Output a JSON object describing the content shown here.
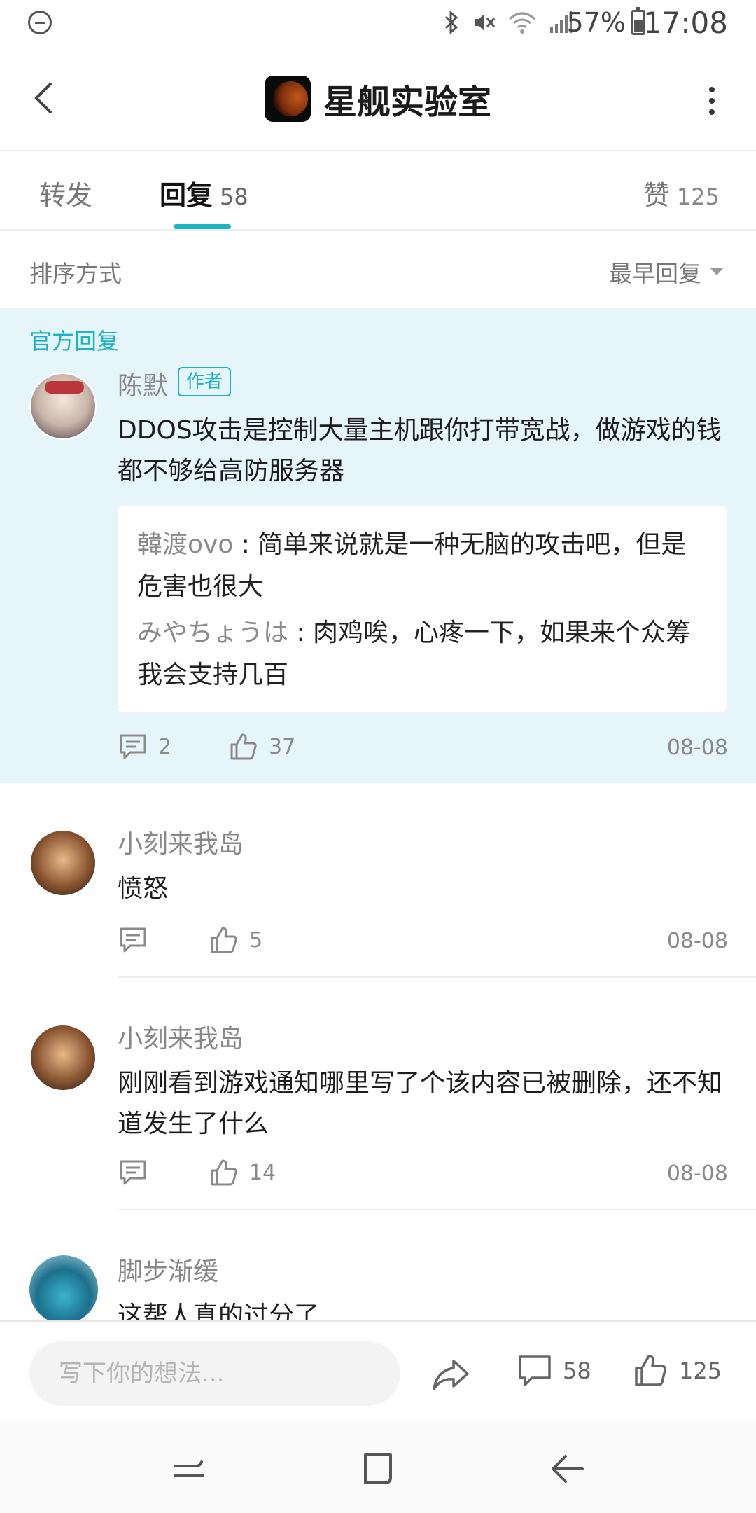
{
  "status_bar": {
    "battery": "57%",
    "time": "17:08",
    "battery_level": 0.57
  },
  "header": {
    "title": "星舰实验室",
    "logo": "moon-logo-icon"
  },
  "tabs": [
    {
      "label": "转发",
      "count": ""
    },
    {
      "label": "回复",
      "count": "58",
      "active": true
    },
    {
      "label": "赞",
      "count": "125"
    }
  ],
  "sort": {
    "label": "排序方式",
    "value": "最早回复"
  },
  "official": {
    "section_label": "官方回复",
    "author": "陈默",
    "badge": "作者",
    "text": "DDOS攻击是控制大量主机跟你打带宽战，做游戏的钱都不够给高防服务器",
    "sub_replies": [
      {
        "name": "韓渡ovo",
        "sep": " : ",
        "text": "简单来说就是一种无脑的攻击吧，但是危害也很大"
      },
      {
        "name": "みやちょうは",
        "sep": " : ",
        "text": "肉鸡唉，心疼一下，如果来个众筹我会支持几百"
      }
    ],
    "comments": "2",
    "likes": "37",
    "date": "08-08"
  },
  "replies": [
    {
      "name": "小刻来我岛",
      "text": "愤怒",
      "comments": "",
      "likes": "5",
      "date": "08-08"
    },
    {
      "name": "小刻来我岛",
      "text": "刚刚看到游戏通知哪里写了个该内容已被删除，还不知道发生了什么",
      "comments": "",
      "likes": "14",
      "date": "08-08"
    },
    {
      "name": "脚步渐缓",
      "text": "这帮人真的过分了"
    }
  ],
  "bottom_bar": {
    "placeholder": "写下你的想法...",
    "comments": "58",
    "likes": "125"
  },
  "colors": {
    "accent": "#1ab3c4",
    "official_bg": "#e5f5fa"
  }
}
